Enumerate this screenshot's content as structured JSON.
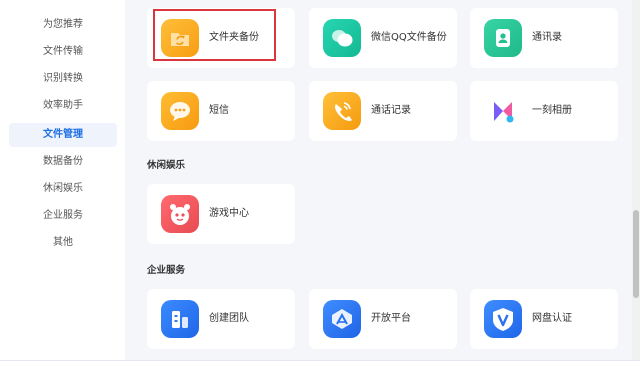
{
  "sidebar": {
    "items": [
      {
        "label": "为您推荐"
      },
      {
        "label": "文件传输"
      },
      {
        "label": "识别转换"
      },
      {
        "label": "效率助手"
      },
      {
        "label": "文件管理",
        "active": true
      },
      {
        "label": "数据备份"
      },
      {
        "label": "休闲娱乐"
      },
      {
        "label": "企业服务"
      },
      {
        "label": "其他"
      }
    ]
  },
  "main": {
    "file_management": {
      "cards": [
        {
          "label": "文件夹备份",
          "icon": "folder-sync-icon",
          "highlighted": true
        },
        {
          "label": "微信QQ文件备份",
          "icon": "chat-bubbles-icon"
        },
        {
          "label": "通讯录",
          "icon": "contacts-icon"
        },
        {
          "label": "短信",
          "icon": "message-icon"
        },
        {
          "label": "通话记录",
          "icon": "phone-call-icon"
        },
        {
          "label": "一刻相册",
          "icon": "album-logo-icon"
        }
      ]
    },
    "leisure": {
      "title": "休闲娱乐",
      "cards": [
        {
          "label": "游戏中心",
          "icon": "game-controller-icon"
        }
      ]
    },
    "enterprise": {
      "title": "企业服务",
      "cards": [
        {
          "label": "创建团队",
          "icon": "team-icon"
        },
        {
          "label": "开放平台",
          "icon": "open-platform-icon"
        },
        {
          "label": "网盘认证",
          "icon": "verified-v-icon"
        }
      ]
    }
  },
  "colors": {
    "accent": "#1f6fe5",
    "highlight_border": "#d9363e",
    "folder_orange": "#fba41c",
    "chat_green": "#1fc9a5",
    "contacts_green": "#2cc79a",
    "game_red": "#f0575e",
    "team_blue": "#2f7bf0"
  }
}
